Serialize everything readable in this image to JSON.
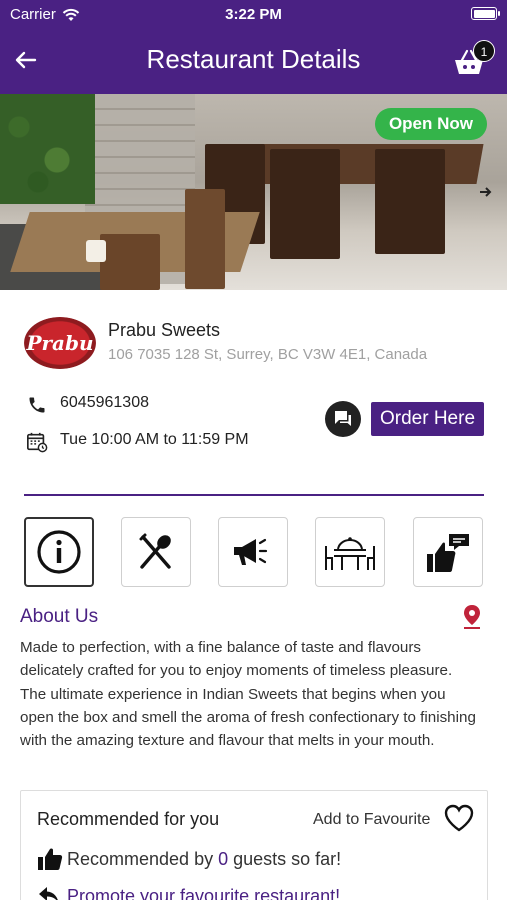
{
  "status_bar": {
    "carrier": "Carrier",
    "time": "3:22 PM"
  },
  "header": {
    "title": "Restaurant Details",
    "cart_count": "1"
  },
  "hero": {
    "open_status": "Open Now"
  },
  "restaurant": {
    "logo_text": "Prabu",
    "name": "Prabu Sweets",
    "address": "106 7035 128 St, Surrey, BC V3W 4E1, Canada",
    "phone": "6045961308",
    "hours": "Tue 10:00 AM to 11:59 PM",
    "order_label": "Order Here"
  },
  "tabs": [
    {
      "icon": "info-icon",
      "active": true
    },
    {
      "icon": "menu-icon",
      "active": false
    },
    {
      "icon": "announcement-icon",
      "active": false
    },
    {
      "icon": "dining-icon",
      "active": false
    },
    {
      "icon": "review-icon",
      "active": false
    }
  ],
  "about": {
    "title": "About Us",
    "text": "Made to perfection, with a fine balance of taste and flavours delicately crafted for you to enjoy moments of timeless pleasure. The ultimate experience in Indian Sweets that begins when you open the box and smell the aroma of fresh confectionary to finishing with the amazing texture and flavour that melts in your mouth."
  },
  "recommend": {
    "title": "Recommended for you",
    "favourite_label": "Add to Favourite",
    "prefix": "Recommended by ",
    "count": "0",
    "suffix": " guests so far!",
    "promote_link": "Promote your favourite restaurant!"
  },
  "colors": {
    "primary": "#4a2183",
    "open_badge": "#34b44a"
  }
}
